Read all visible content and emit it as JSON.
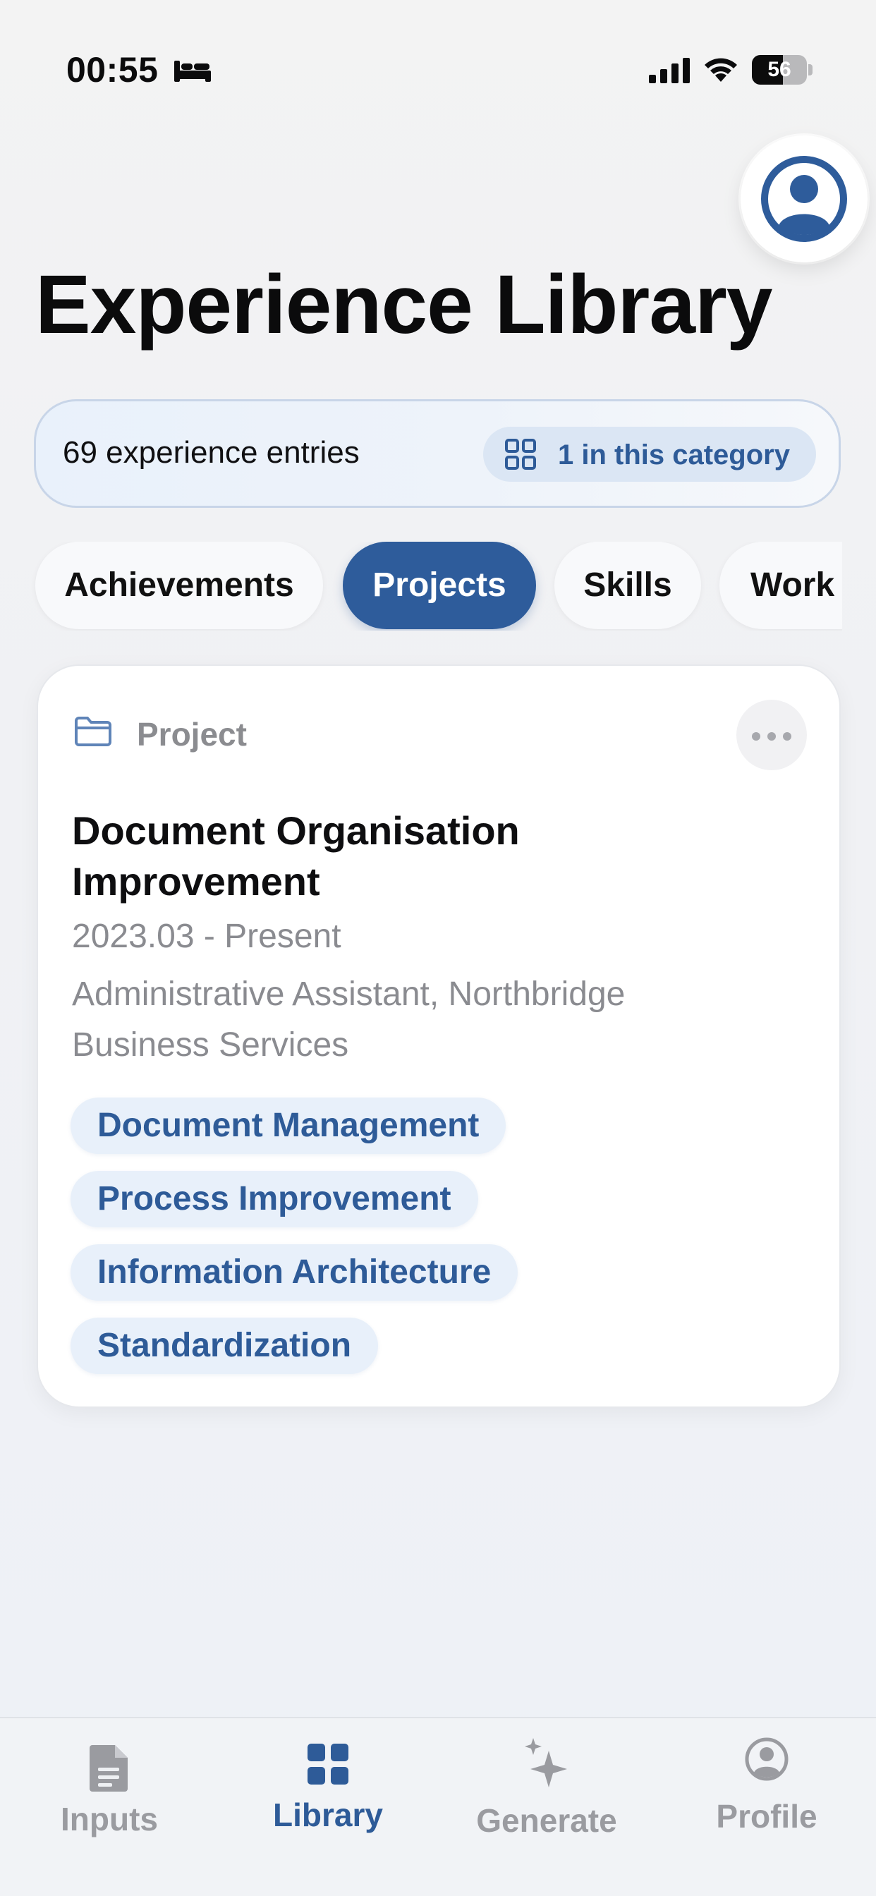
{
  "status_bar": {
    "time": "00:55",
    "battery_percent": 56,
    "battery_text": "56",
    "sleep_icon": "bed-icon",
    "signal_icon": "cellular-signal-icon",
    "wifi_icon": "wifi-icon"
  },
  "header": {
    "title": "Experience Library",
    "profile_icon": "person-circle-icon"
  },
  "summary": {
    "entry_count": "69 experience entries",
    "category_count": "1 in this category",
    "category_icon": "grid-icon"
  },
  "tabs": [
    {
      "label": "Achievements",
      "active": false
    },
    {
      "label": "Projects",
      "active": true
    },
    {
      "label": "Skills",
      "active": false
    },
    {
      "label": "Work",
      "active": false
    }
  ],
  "entries": [
    {
      "type": "Project",
      "type_icon": "folder-icon",
      "title": "Document Organisation Improvement",
      "date": "2023.03 - Present",
      "role": "Administrative Assistant, Northbridge Business Services",
      "tags": [
        "Document Management",
        "Process Improvement",
        "Information Architecture",
        "Standardization"
      ]
    }
  ],
  "bottom_nav": [
    {
      "label": "Inputs",
      "icon": "document-icon",
      "selected": false
    },
    {
      "label": "Library",
      "icon": "grid-icon",
      "selected": true
    },
    {
      "label": "Generate",
      "icon": "sparkles-icon",
      "selected": false
    },
    {
      "label": "Profile",
      "icon": "person-circle-icon",
      "selected": false
    }
  ],
  "colors": {
    "accent": "#2e5c9b",
    "tag_background": "#e8f0fa",
    "muted_text": "#8a8b90"
  }
}
